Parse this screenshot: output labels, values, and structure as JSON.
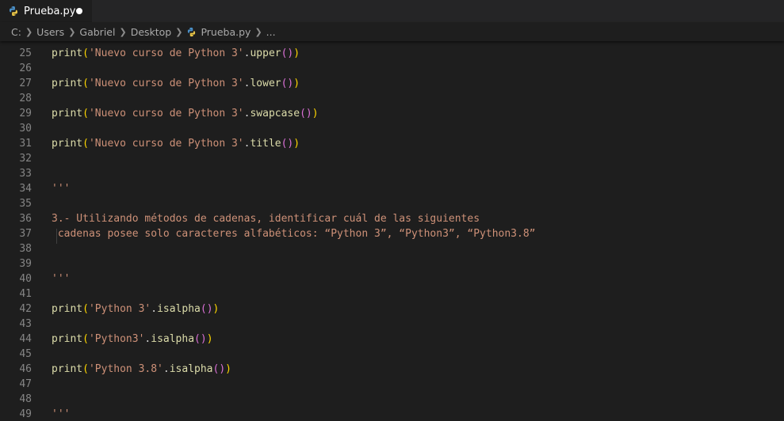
{
  "tab": {
    "filename": "Prueba.py"
  },
  "breadcrumb": {
    "items": [
      "C:",
      "Users",
      "Gabriel",
      "Desktop"
    ],
    "file": "Prueba.py",
    "tail": "..."
  },
  "colors": {
    "function": "#dcdcaa",
    "string": "#ce9178",
    "bracket_level1": "#ffd700",
    "bracket_level2": "#da70d6",
    "line_number": "#858585"
  },
  "editor": {
    "lines": [
      {
        "num": "25",
        "tokens": [
          [
            "fn",
            "print"
          ],
          [
            "p1",
            "("
          ],
          [
            "str",
            "'Nuevo curso de Python 3'"
          ],
          [
            "plain",
            "."
          ],
          [
            "fn",
            "upper"
          ],
          [
            "p2",
            "()"
          ],
          [
            "p1",
            ")"
          ]
        ]
      },
      {
        "num": "26",
        "tokens": []
      },
      {
        "num": "27",
        "tokens": [
          [
            "fn",
            "print"
          ],
          [
            "p1",
            "("
          ],
          [
            "str",
            "'Nuevo curso de Python 3'"
          ],
          [
            "plain",
            "."
          ],
          [
            "fn",
            "lower"
          ],
          [
            "p2",
            "()"
          ],
          [
            "p1",
            ")"
          ]
        ]
      },
      {
        "num": "28",
        "tokens": []
      },
      {
        "num": "29",
        "tokens": [
          [
            "fn",
            "print"
          ],
          [
            "p1",
            "("
          ],
          [
            "str",
            "'Nuevo curso de Python 3'"
          ],
          [
            "plain",
            "."
          ],
          [
            "fn",
            "swapcase"
          ],
          [
            "p2",
            "()"
          ],
          [
            "p1",
            ")"
          ]
        ]
      },
      {
        "num": "30",
        "tokens": []
      },
      {
        "num": "31",
        "tokens": [
          [
            "fn",
            "print"
          ],
          [
            "p1",
            "("
          ],
          [
            "str",
            "'Nuevo curso de Python 3'"
          ],
          [
            "plain",
            "."
          ],
          [
            "fn",
            "title"
          ],
          [
            "p2",
            "()"
          ],
          [
            "p1",
            ")"
          ]
        ]
      },
      {
        "num": "32",
        "tokens": []
      },
      {
        "num": "33",
        "tokens": []
      },
      {
        "num": "34",
        "tokens": [
          [
            "str",
            "'''"
          ]
        ]
      },
      {
        "num": "35",
        "tokens": []
      },
      {
        "num": "36",
        "tokens": [
          [
            "str",
            "3.- Utilizando métodos de cadenas, identificar cuál de las siguientes"
          ]
        ]
      },
      {
        "num": "37",
        "tokens": [
          [
            "str",
            " cadenas posee solo caracteres alfabéticos: “Python 3”, “Python3”, “Python3.8”"
          ]
        ]
      },
      {
        "num": "38",
        "tokens": []
      },
      {
        "num": "39",
        "tokens": []
      },
      {
        "num": "40",
        "tokens": [
          [
            "str",
            "'''"
          ]
        ]
      },
      {
        "num": "41",
        "tokens": []
      },
      {
        "num": "42",
        "tokens": [
          [
            "fn",
            "print"
          ],
          [
            "p1",
            "("
          ],
          [
            "str",
            "'Python 3'"
          ],
          [
            "plain",
            "."
          ],
          [
            "fn",
            "isalpha"
          ],
          [
            "p2",
            "()"
          ],
          [
            "p1",
            ")"
          ]
        ]
      },
      {
        "num": "43",
        "tokens": []
      },
      {
        "num": "44",
        "tokens": [
          [
            "fn",
            "print"
          ],
          [
            "p1",
            "("
          ],
          [
            "str",
            "'Python3'"
          ],
          [
            "plain",
            "."
          ],
          [
            "fn",
            "isalpha"
          ],
          [
            "p2",
            "()"
          ],
          [
            "p1",
            ")"
          ]
        ]
      },
      {
        "num": "45",
        "tokens": []
      },
      {
        "num": "46",
        "tokens": [
          [
            "fn",
            "print"
          ],
          [
            "p1",
            "("
          ],
          [
            "str",
            "'Python 3.8'"
          ],
          [
            "plain",
            "."
          ],
          [
            "fn",
            "isalpha"
          ],
          [
            "p2",
            "()"
          ],
          [
            "p1",
            ")"
          ]
        ]
      },
      {
        "num": "47",
        "tokens": []
      },
      {
        "num": "48",
        "tokens": []
      },
      {
        "num": "49",
        "tokens": [
          [
            "str",
            "'''"
          ]
        ]
      }
    ]
  }
}
